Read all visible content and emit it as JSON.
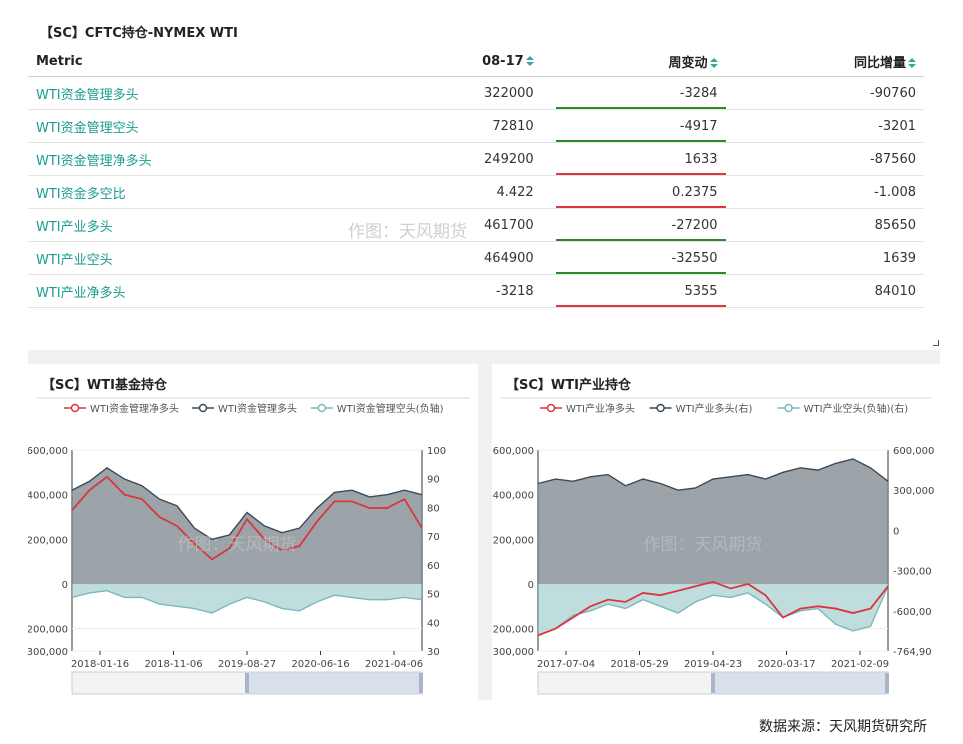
{
  "table": {
    "title": "【SC】CFTC持仓-NYMEX WTI",
    "headers": {
      "metric": "Metric",
      "value": "08-17",
      "change": "周变动",
      "yoy": "同比增量"
    },
    "rows": [
      {
        "metric": "WTI资金管理多头",
        "value": "322000",
        "change": "-3284",
        "yoy": "-90760",
        "dir": "pos"
      },
      {
        "metric": "WTI资金管理空头",
        "value": "72810",
        "change": "-4917",
        "yoy": "-3201",
        "dir": "pos"
      },
      {
        "metric": "WTI资金管理净多头",
        "value": "249200",
        "change": "1633",
        "yoy": "-87560",
        "dir": "neg"
      },
      {
        "metric": "WTI资金多空比",
        "value": "4.422",
        "change": "0.2375",
        "yoy": "-1.008",
        "dir": "neg"
      },
      {
        "metric": "WTI产业多头",
        "value": "461700",
        "change": "-27200",
        "yoy": "85650",
        "dir": "pos"
      },
      {
        "metric": "WTI产业空头",
        "value": "464900",
        "change": "-32550",
        "yoy": "1639",
        "dir": "pos"
      },
      {
        "metric": "WTI产业净多头",
        "value": "-3218",
        "change": "5355",
        "yoy": "84010",
        "dir": "neg"
      }
    ],
    "watermark": "作图：天风期货"
  },
  "source": "数据来源：天风期货研究所",
  "colors": {
    "red": "#d9363e",
    "dark": "#3d4a55",
    "teal": "#7bb8bb",
    "green": "#2b8a2b",
    "accent": "#1a9d8f"
  },
  "chart_data": [
    {
      "type": "area",
      "title": "【SC】WTI基金持仓",
      "watermark": "作图：天风期货",
      "legend": [
        "WTI资金管理净多头",
        "WTI资金管理多头",
        "WTI资金管理空头(负轴)"
      ],
      "legend_position": "top",
      "x_ticks": [
        "2018-01-16",
        "2018-11-06",
        "2019-08-27",
        "2020-06-16",
        "2021-04-06"
      ],
      "y_left_ticks": [
        "600,000",
        "400,000",
        "200,000",
        "0",
        "200,000",
        "300,000"
      ],
      "y_right_ticks": [
        "100",
        "90",
        "80",
        "70",
        "60",
        "50",
        "40",
        "30"
      ],
      "ylim": [
        -300000,
        600000
      ],
      "series": [
        {
          "name": "WTI资金管理多头",
          "values": [
            420000,
            460000,
            520000,
            470000,
            440000,
            380000,
            350000,
            250000,
            200000,
            220000,
            320000,
            260000,
            230000,
            250000,
            340000,
            410000,
            420000,
            390000,
            400000,
            420000,
            400000
          ]
        },
        {
          "name": "WTI资金管理净多头",
          "values": [
            330000,
            420000,
            480000,
            400000,
            380000,
            300000,
            260000,
            180000,
            110000,
            160000,
            290000,
            200000,
            150000,
            170000,
            280000,
            370000,
            370000,
            340000,
            340000,
            380000,
            250000
          ]
        },
        {
          "name": "WTI资金管理空头(负轴)",
          "values": [
            -60000,
            -40000,
            -30000,
            -60000,
            -60000,
            -90000,
            -100000,
            -110000,
            -130000,
            -90000,
            -60000,
            -80000,
            -110000,
            -120000,
            -80000,
            -50000,
            -60000,
            -70000,
            -70000,
            -60000,
            -70000
          ]
        }
      ]
    },
    {
      "type": "area",
      "title": "【SC】WTI产业持仓",
      "watermark": "作图：天风期货",
      "legend": [
        "WTI产业净多头",
        "WTI产业多头(右)",
        "WTI产业空头(负轴)(右)"
      ],
      "legend_position": "top",
      "x_ticks": [
        "2017-07-04",
        "2018-05-29",
        "2019-04-23",
        "2020-03-17",
        "2021-02-09"
      ],
      "y_left_ticks": [
        "600,000",
        "400,000",
        "200,000",
        "0",
        "200,000",
        "300,000"
      ],
      "y_right_ticks": [
        "600,000",
        "300,000",
        "0",
        "-300,00",
        "-600,00",
        "-764,90"
      ],
      "ylim": [
        -300000,
        600000
      ],
      "series": [
        {
          "name": "WTI产业多头(右)",
          "values": [
            450000,
            470000,
            460000,
            480000,
            490000,
            440000,
            470000,
            450000,
            420000,
            430000,
            470000,
            480000,
            490000,
            470000,
            500000,
            520000,
            510000,
            540000,
            560000,
            520000,
            460000
          ]
        },
        {
          "name": "WTI产业空头(负轴)(右)",
          "values": [
            -230000,
            -200000,
            -140000,
            -120000,
            -90000,
            -110000,
            -70000,
            -100000,
            -130000,
            -80000,
            -50000,
            -60000,
            -40000,
            -90000,
            -150000,
            -120000,
            -110000,
            -180000,
            -210000,
            -190000,
            -10000
          ]
        },
        {
          "name": "WTI产业净多头",
          "values": [
            -230000,
            -200000,
            -150000,
            -100000,
            -70000,
            -80000,
            -40000,
            -50000,
            -30000,
            -10000,
            10000,
            -20000,
            0,
            -50000,
            -150000,
            -110000,
            -100000,
            -110000,
            -130000,
            -110000,
            -10000
          ]
        }
      ]
    }
  ]
}
